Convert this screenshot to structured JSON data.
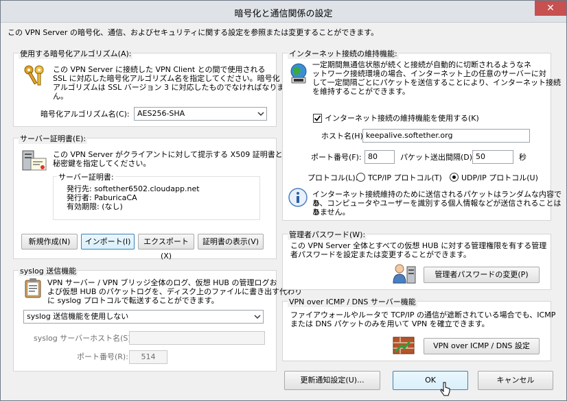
{
  "window": {
    "title": "暗号化と通信関係の設定",
    "close": "✕"
  },
  "intro": "この VPN Server の暗号化、通信、およびセキュリティに関する設定を参照または変更することができます。",
  "crypto": {
    "group_label": "使用する暗号化アルゴリズム(A):",
    "desc_lines": [
      "この VPN Server に接続した VPN Client との間で使用される",
      "SSL に対応した暗号化アルゴリズム名を指定してください。暗号化",
      "アルゴリズムは SSL バージョン 3 に対応したものでなければなりませ",
      "ん。"
    ],
    "algo_label": "暗号化アルゴリズム名(C):",
    "algo_value": "AES256-SHA"
  },
  "cert": {
    "group_label": "サーバー証明書(E):",
    "desc_lines": [
      "この VPN Server がクライアントに対して提示する X509 証明書と",
      "秘密鍵を指定してください。"
    ],
    "inner_label": "サーバー証明書:",
    "issued_to": "発行先: softether6502.cloudapp.net",
    "issuer": "発行者: PaburicaCA",
    "validity": "有効期限: (なし)",
    "buttons": {
      "new": "新規作成(N)",
      "import": "インポート(I)",
      "export": "エクスポート(X)",
      "view": "証明書の表示(V)"
    }
  },
  "syslog": {
    "group_label": "syslog 送信機能",
    "desc_lines": [
      "VPN サーバー / VPN ブリッジ全体のログ、仮想 HUB の管理ログお",
      "よび仮想 HUB のパケットログを、ディスク上のファイルに書き出す代わり",
      "に syslog プロトコルで転送することができます。"
    ],
    "mode_value": "syslog 送信機能を使用しない",
    "host_label": "syslog サーバーホスト名(S):",
    "host_value": "",
    "port_label": "ポート番号(R):",
    "port_value": "514"
  },
  "keepalive": {
    "group_label": "インターネット接続の維持機能:",
    "desc_lines": [
      "一定期間無通信状態が続くと接続が自動的に切断されるようなネ",
      "ットワーク接続環境の場合、インターネット上の任意のサーバーに対",
      "して一定間隔ごとにパケットを送信することにより、インターネット接続",
      "を維持することができます。"
    ],
    "enable_label": "インターネット接続の維持機能を使用する(K)",
    "host_label": "ホスト名(H):",
    "host_value": "keepalive.softether.org",
    "port_label": "ポート番号(F):",
    "port_value": "80",
    "interval_label": "パケット送出間隔(D):",
    "interval_value": "50",
    "interval_unit": "秒",
    "protocol_label": "プロトコル(L):",
    "tcp_label": "TCP/IP プロトコル(T)",
    "udp_label": "UDP/IP プロトコル(U)",
    "info_lines": [
      "インターネット接続維持のために送信されるパケットはランダムな内容であ",
      "り、コンピュータやユーザーを識別する個人情報などが送信されることはあ",
      "りません。"
    ]
  },
  "admin": {
    "group_label": "管理者パスワード(W):",
    "desc_lines": [
      "この VPN Server 全体とすべての仮想 HUB に対する管理権限を有する管理",
      "者パスワードを設定または変更することができます。"
    ],
    "button": "管理者パスワードの変更(P)"
  },
  "icmp": {
    "group_label": "VPN over ICMP / DNS サーバー機能",
    "desc_lines": [
      "ファイアウォールやルータで TCP/IP の通信が遮断されている場合でも、ICMP",
      "または DNS パケットのみを用いて VPN を確立できます。"
    ],
    "button": "VPN over ICMP / DNS 設定"
  },
  "footer": {
    "update": "更新通知設定(U)...",
    "ok": "OK",
    "cancel": "キャンセル"
  }
}
